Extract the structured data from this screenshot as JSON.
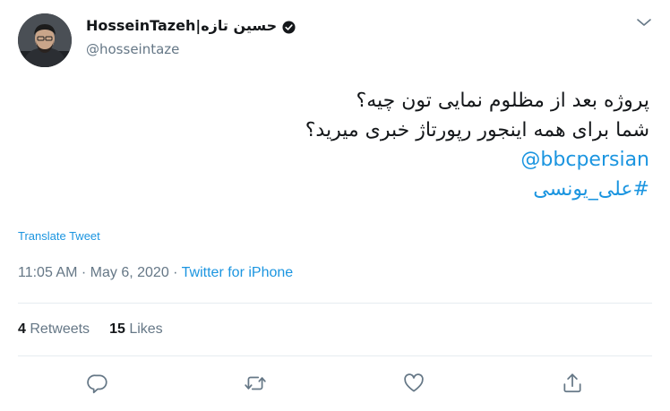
{
  "author": {
    "display_name": "HosseinTazeh|حسین تازه",
    "handle": "@hosseintaze",
    "avatar": "user-photo",
    "verified_icon": "verified-badge-icon"
  },
  "tweet": {
    "lines": [
      "پروژه بعد از مظلوم نمایی تون چیه؟",
      "شما برای همه اینجور رپورتاژ خبری میرید؟",
      "@bbcpersian",
      "#علی_یونسی"
    ],
    "translate_label": "Translate Tweet",
    "time": "11:05 AM",
    "separator": "·",
    "date": "May 6, 2020",
    "source": "Twitter for iPhone"
  },
  "stats": {
    "retweets_count": "4",
    "retweets_label": "Retweets",
    "likes_count": "15",
    "likes_label": "Likes"
  },
  "actions": {
    "reply": "reply-icon",
    "retweet": "retweet-icon",
    "like": "heart-icon",
    "share": "share-icon"
  },
  "menu": {
    "caret": "chevron-down-icon"
  },
  "colors": {
    "link": "#1b95e0",
    "muted": "#657786",
    "text": "#14171a",
    "divider": "#e6ecf0"
  }
}
